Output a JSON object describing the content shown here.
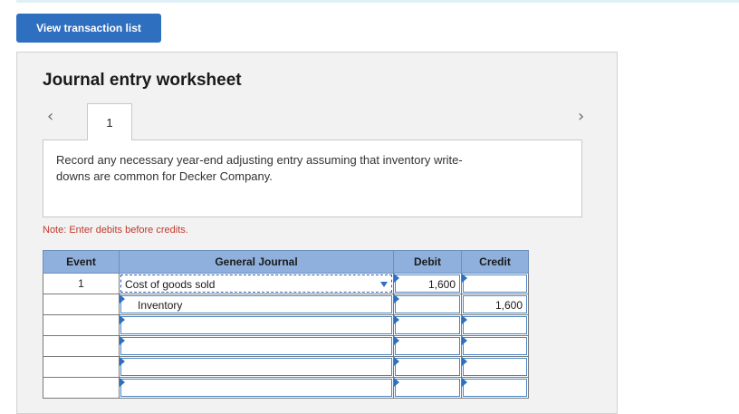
{
  "toolbar": {
    "view_transactions_label": "View transaction list"
  },
  "worksheet": {
    "title": "Journal entry worksheet",
    "prev_icon": "chevron-left-icon",
    "next_icon": "chevron-right-icon",
    "prev_glyph": "‹",
    "next_glyph": "›",
    "tabs": [
      {
        "label": "1"
      }
    ],
    "instruction_line1": "Record any necessary year-end adjusting entry assuming that inventory write-",
    "instruction_line2": "downs are common for Decker Company.",
    "note": "Note: Enter debits before credits."
  },
  "journal": {
    "headers": {
      "event": "Event",
      "account": "General Journal",
      "debit": "Debit",
      "credit": "Credit"
    },
    "rows": [
      {
        "event": "1",
        "account": "Cost of goods sold",
        "debit": "1,600",
        "credit": ""
      },
      {
        "event": "",
        "account": "Inventory",
        "debit": "",
        "credit": "1,600"
      },
      {
        "event": "",
        "account": "",
        "debit": "",
        "credit": ""
      },
      {
        "event": "",
        "account": "",
        "debit": "",
        "credit": ""
      },
      {
        "event": "",
        "account": "",
        "debit": "",
        "credit": ""
      },
      {
        "event": "",
        "account": "",
        "debit": "",
        "credit": ""
      }
    ]
  },
  "colors": {
    "accent": "#2f6fbf",
    "header_bg": "#8fb0dc",
    "note": "#c0392b"
  }
}
